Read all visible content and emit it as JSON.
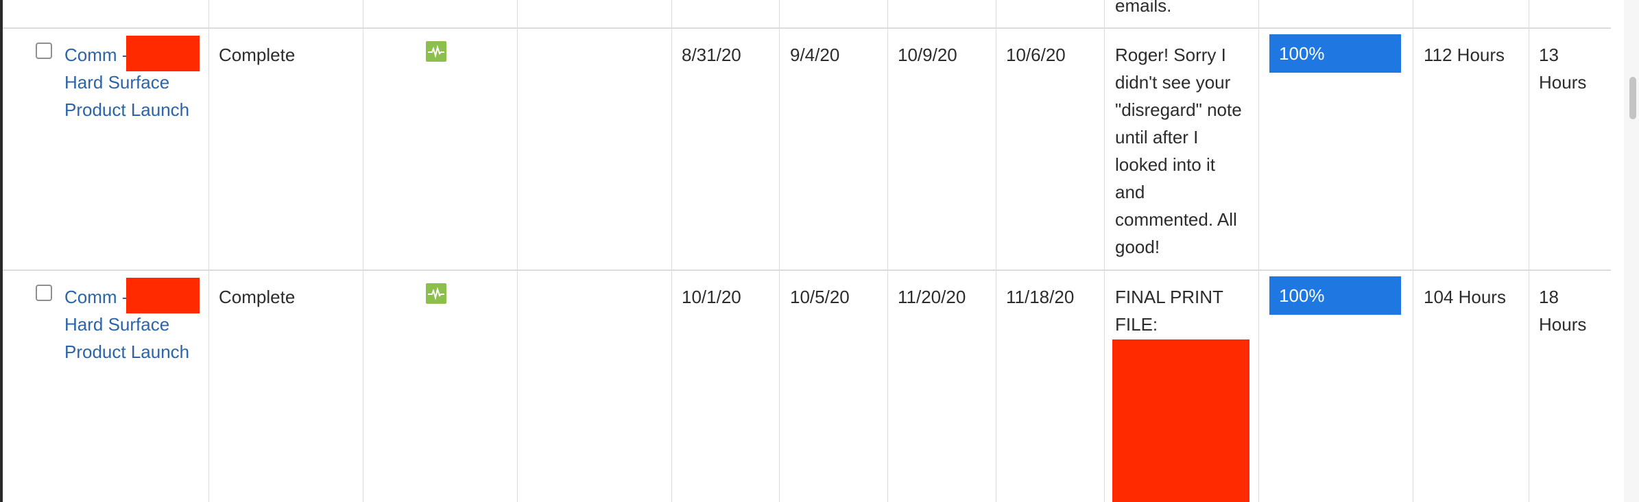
{
  "top_row": {
    "notes_fragment": "emails."
  },
  "rows": [
    {
      "task_name_line1": "Comm -",
      "task_name_line2": "Hard Surface",
      "task_name_line3": "Product Launch",
      "status": "Complete",
      "health_icon": "health-pulse-icon",
      "start_date": "8/31/20",
      "planned_start": "9/4/20",
      "due_date": "10/9/20",
      "completed_date": "10/6/20",
      "notes": [
        "Roger! Sorry I",
        "didn't see your",
        "\"disregard\" note",
        "until after I",
        "looked into it",
        "and",
        "commented. All",
        "good!"
      ],
      "percent_complete": "100%",
      "percent_value": 1.0,
      "planned_hours": "112 Hours",
      "actual_hours_line1": "13",
      "actual_hours_line2": "Hours"
    },
    {
      "task_name_line1": "Comm -",
      "task_name_line2": "Hard Surface",
      "task_name_line3": "Product Launch",
      "status": "Complete",
      "health_icon": "health-pulse-icon",
      "start_date": "10/1/20",
      "planned_start": "10/5/20",
      "due_date": "11/20/20",
      "completed_date": "11/18/20",
      "notes": [
        "FINAL PRINT",
        "FILE:"
      ],
      "percent_complete": "100%",
      "percent_value": 1.0,
      "planned_hours": "104 Hours",
      "actual_hours_line1": "18",
      "actual_hours_line2": "Hours"
    }
  ],
  "colors": {
    "link": "#2b64a8",
    "progress": "#1f78e1",
    "health_ok": "#8cbf4b",
    "redaction": "#ff2a00",
    "grid": "#dcdcdc"
  }
}
